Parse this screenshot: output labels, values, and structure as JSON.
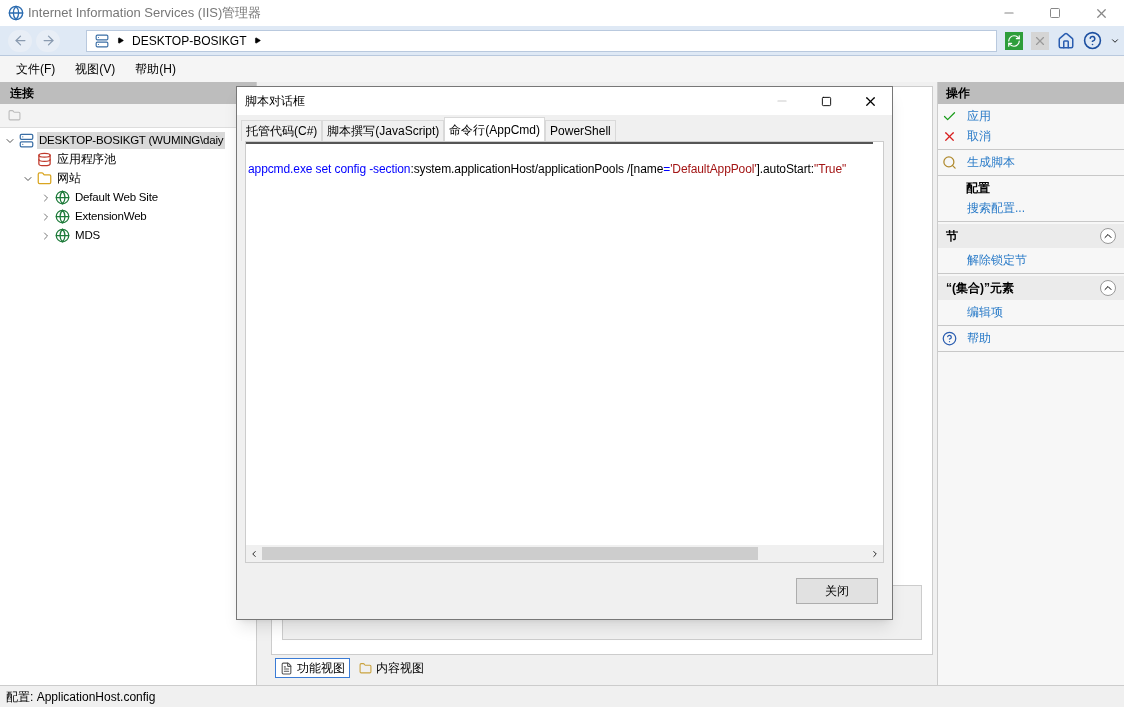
{
  "window": {
    "title": "Internet Information Services (IIS)管理器"
  },
  "address_bar": {
    "path": [
      "DESKTOP-BOSIKGT"
    ]
  },
  "menu": [
    "文件(F)",
    "视图(V)",
    "帮助(H)"
  ],
  "connections": {
    "title": "连接",
    "tree": [
      {
        "label": "DESKTOP-BOSIKGT (WUMING\\daiy",
        "kind": "server",
        "expanded": true,
        "selected": true,
        "children": [
          {
            "label": "应用程序池",
            "kind": "pool"
          },
          {
            "label": "网站",
            "kind": "folder",
            "expanded": true,
            "children": [
              {
                "label": "Default Web Site",
                "kind": "site",
                "expanded": false
              },
              {
                "label": "ExtensionWeb",
                "kind": "site",
                "expanded": false
              },
              {
                "label": "MDS",
                "kind": "site",
                "expanded": false
              }
            ]
          }
        ]
      }
    ]
  },
  "view_tabs": [
    {
      "label": "功能视图",
      "selected": true
    },
    {
      "label": "内容视图",
      "selected": false
    }
  ],
  "actions": {
    "title": "操作",
    "groups": [
      {
        "items": [
          {
            "label": "应用",
            "kind": "apply"
          },
          {
            "label": "取消",
            "kind": "cancel"
          }
        ]
      },
      {
        "items": [
          {
            "label": "生成脚本",
            "kind": "script"
          }
        ]
      },
      {
        "heading": "配置",
        "items": [
          {
            "label": "搜索配置...",
            "kind": "link"
          }
        ]
      },
      {
        "section": "节",
        "items": [
          {
            "label": "解除锁定节",
            "kind": "link"
          }
        ]
      },
      {
        "section": "“(集合)”元素",
        "items": [
          {
            "label": "编辑项",
            "kind": "link"
          }
        ]
      },
      {
        "items": [
          {
            "label": "帮助",
            "kind": "help"
          }
        ]
      }
    ]
  },
  "dialog": {
    "title": "脚本对话框",
    "tabs": [
      {
        "label": "托管代码(C#)",
        "selected": false
      },
      {
        "label": "脚本撰写(JavaScript)",
        "selected": false
      },
      {
        "label": "命令行(AppCmd)",
        "selected": true
      },
      {
        "label": "PowerShell",
        "selected": false
      }
    ],
    "code": [
      {
        "text": "appcmd.exe set config  -section",
        "kind": "keyword"
      },
      {
        "text": ":system.applicationHost/applicationPools /[name",
        "kind": "plain"
      },
      {
        "text": "=",
        "kind": "keyword"
      },
      {
        "text": "'DefaultAppPool'",
        "kind": "string"
      },
      {
        "text": "].autoStart:",
        "kind": "plain"
      },
      {
        "text": "\"True\"",
        "kind": "string"
      }
    ],
    "close_button": "关闭"
  },
  "status_bar": {
    "text": "配置: ApplicationHost.config"
  }
}
